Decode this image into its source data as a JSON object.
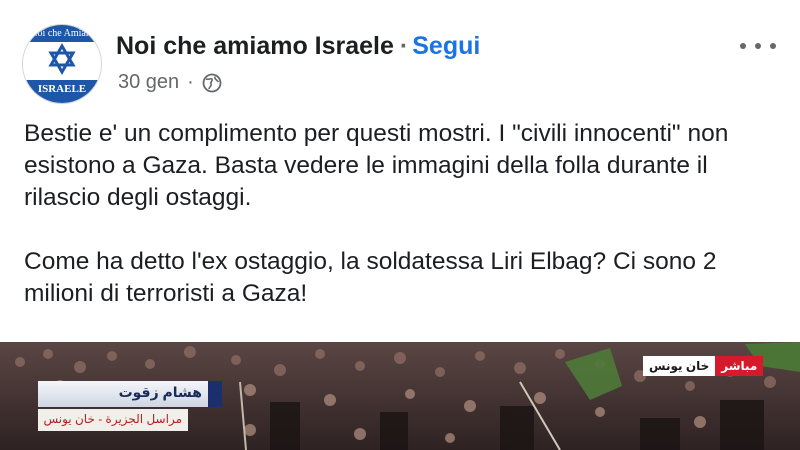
{
  "page": {
    "avatar_text_top": "Noi che Amiam",
    "avatar_text_bottom": "ISRAELE",
    "name": "Noi che amiamo Israele",
    "separator": "·",
    "follow_label": "Segui",
    "date": "30 gen",
    "meta_separator": "·",
    "audience_icon": "globe-icon",
    "more_icon": "more-options-icon"
  },
  "post": {
    "paragraphs": [
      "Bestie e' un complimento per questi mostri. I \"civili innocenti\" non esistono a Gaza. Basta vedere le immagini della folla durante il rilascio degli ostaggi.",
      "Come ha detto l'ex ostaggio, la soldatessa Liri Elbag? Ci sono 2 milioni di terroristi a Gaza!"
    ]
  },
  "media": {
    "lower_third_name": "هشام زقوت",
    "lower_third_role": "مراسل الجزيرة - خان يونس",
    "live_label": "مباشر",
    "live_place": "خان يونس"
  },
  "colors": {
    "link": "#1b74e4",
    "text": "#1c1e21",
    "secondary": "#65676b",
    "flag_blue": "#1f57a8",
    "live_red": "#d6192b"
  }
}
